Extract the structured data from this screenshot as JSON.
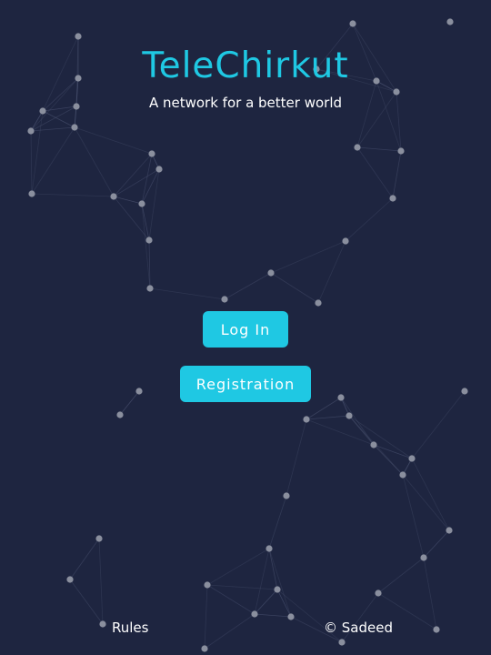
{
  "app": {
    "title": "TeleChirkut",
    "tagline": "A network for a better world"
  },
  "actions": {
    "login_label": "Log In",
    "register_label": "Registration"
  },
  "footer": {
    "rules_label": "Rules",
    "copyright": "© Sadeed"
  },
  "colors": {
    "background": "#1e2540",
    "accent": "#1fc8e3",
    "node": "#8a8f9e",
    "link": "#4a5270"
  }
}
